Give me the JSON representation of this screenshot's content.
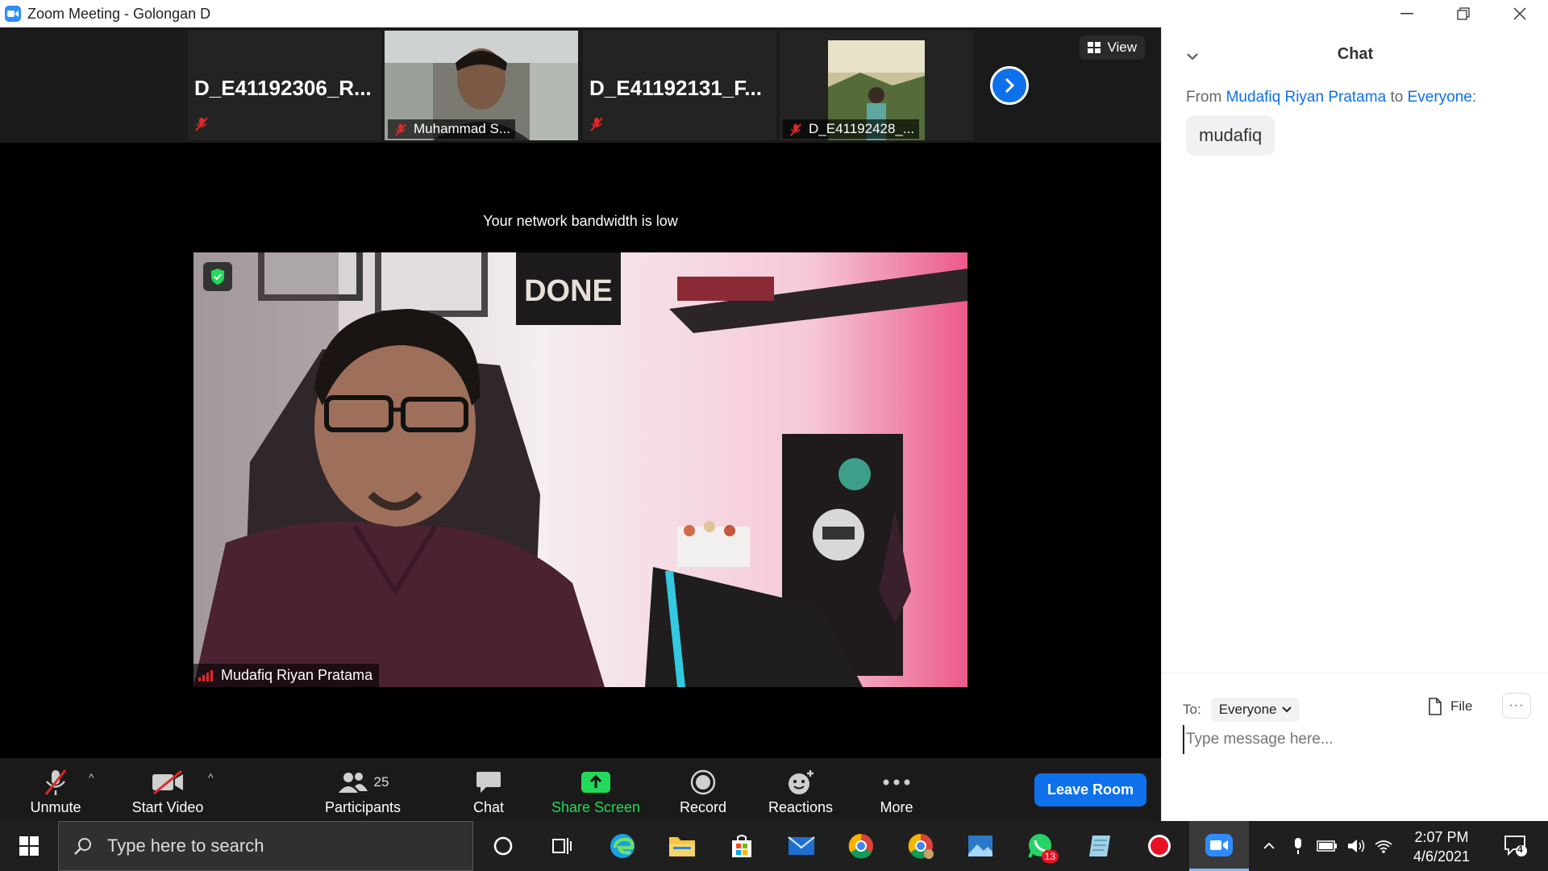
{
  "window": {
    "title": "Zoom Meeting - Golongan D"
  },
  "strip": {
    "tiles": [
      {
        "name": "D_E41192306_R...",
        "label": ""
      },
      {
        "name": "",
        "label": "Muhammad S..."
      },
      {
        "name": "D_E41192131_F...",
        "label": ""
      },
      {
        "name": "",
        "label": "D_E41192428_..."
      }
    ],
    "view_label": "View"
  },
  "bandwidth_notice": "Your network bandwidth is low",
  "main_video": {
    "speaker": "Mudafiq Riyan Pratama"
  },
  "toolbar": {
    "unmute": "Unmute",
    "start_video": "Start Video",
    "participants": "Participants",
    "participants_count": "25",
    "chat": "Chat",
    "share_screen": "Share Screen",
    "record": "Record",
    "reactions": "Reactions",
    "more": "More",
    "leave": "Leave Room"
  },
  "chat_panel": {
    "title": "Chat",
    "from_prefix": "From",
    "from_name": "Mudafiq Riyan Pratama",
    "to_word": "to",
    "to_name": "Everyone",
    "to_suffix": ":",
    "message": "mudafiq",
    "to_label": "To:",
    "recipient": "Everyone",
    "file_label": "File",
    "more_label": "···",
    "input_placeholder": "Type message here..."
  },
  "taskbar": {
    "search_placeholder": "Type here to search",
    "whatsapp_badge": "13",
    "time": "2:07 PM",
    "date": "4/6/2021",
    "notification_count": "4"
  },
  "colors": {
    "zoom_blue": "#0e71eb",
    "share_green": "#23d959",
    "toolbar_bg": "#1a1a1a"
  }
}
